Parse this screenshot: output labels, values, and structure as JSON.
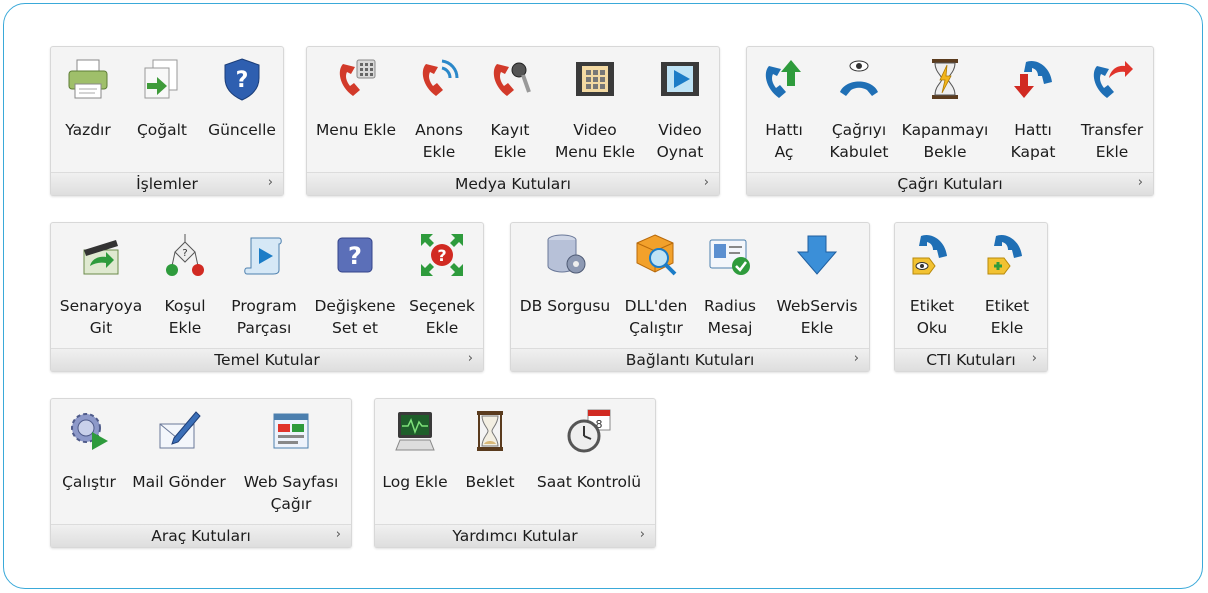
{
  "groups": {
    "islemler": {
      "title": "İşlemler",
      "buttons": [
        {
          "label": "Yazdır",
          "icon": "printer-icon"
        },
        {
          "label": "Çoğalt",
          "icon": "copy-document-icon"
        },
        {
          "label": "Güncelle",
          "icon": "shield-update-icon"
        }
      ]
    },
    "medya": {
      "title": "Medya Kutuları",
      "buttons": [
        {
          "label": "Menu Ekle",
          "icon": "phone-keypad-icon"
        },
        {
          "label": "Anons\nEkle",
          "icon": "phone-broadcast-icon"
        },
        {
          "label": "Kayıt\nEkle",
          "icon": "phone-microphone-icon"
        },
        {
          "label": "Video\nMenu Ekle",
          "icon": "film-keypad-icon"
        },
        {
          "label": "Video\nOynat",
          "icon": "film-play-icon"
        }
      ]
    },
    "cagri": {
      "title": "Çağrı Kutuları",
      "buttons": [
        {
          "label": "Hattı\nAç",
          "icon": "phone-up-arrow-icon"
        },
        {
          "label": "Çağrıyı\nKabulet",
          "icon": "phone-accept-eye-icon"
        },
        {
          "label": "Kapanmayı\nBekle",
          "icon": "hourglass-lightning-icon"
        },
        {
          "label": "Hattı\nKapat",
          "icon": "phone-down-arrow-icon"
        },
        {
          "label": "Transfer\nEkle",
          "icon": "phone-transfer-icon"
        }
      ]
    },
    "temel": {
      "title": "Temel Kutular",
      "buttons": [
        {
          "label": "Senaryoya\nGit",
          "icon": "clapper-arrow-icon"
        },
        {
          "label": "Koşul\nEkle",
          "icon": "condition-flow-icon"
        },
        {
          "label": "Program\nParçası",
          "icon": "scroll-play-icon"
        },
        {
          "label": "Değişkene\nSet et",
          "icon": "question-box-icon"
        },
        {
          "label": "Seçenek\nEkle",
          "icon": "question-arrows-icon"
        }
      ]
    },
    "baglanti": {
      "title": "Bağlantı Kutuları",
      "buttons": [
        {
          "label": "DB Sorgusu",
          "icon": "database-gear-icon"
        },
        {
          "label": "DLL'den\nÇalıştır",
          "icon": "cube-magnifier-icon"
        },
        {
          "label": "Radius\nMesaj",
          "icon": "id-card-check-icon"
        },
        {
          "label": "WebServis\nEkle",
          "icon": "download-arrow-icon"
        }
      ]
    },
    "cti": {
      "title": "CTI Kutuları",
      "buttons": [
        {
          "label": "Etiket\nOku",
          "icon": "phone-tag-eye-icon"
        },
        {
          "label": "Etiket\nEkle",
          "icon": "phone-tag-add-icon"
        }
      ]
    },
    "arac": {
      "title": "Araç Kutuları",
      "buttons": [
        {
          "label": "Çalıştır",
          "icon": "gear-play-icon"
        },
        {
          "label": "Mail Gönder",
          "icon": "envelope-pen-icon"
        },
        {
          "label": "Web Sayfası\nÇağır",
          "icon": "web-page-icon"
        }
      ]
    },
    "yardimci": {
      "title": "Yardımcı Kutular",
      "buttons": [
        {
          "label": "Log Ekle",
          "icon": "monitor-log-icon"
        },
        {
          "label": "Beklet",
          "icon": "hourglass-icon"
        },
        {
          "label": "Saat Kontrolü",
          "icon": "clock-calendar-icon"
        }
      ]
    }
  },
  "more_glyph": "›"
}
